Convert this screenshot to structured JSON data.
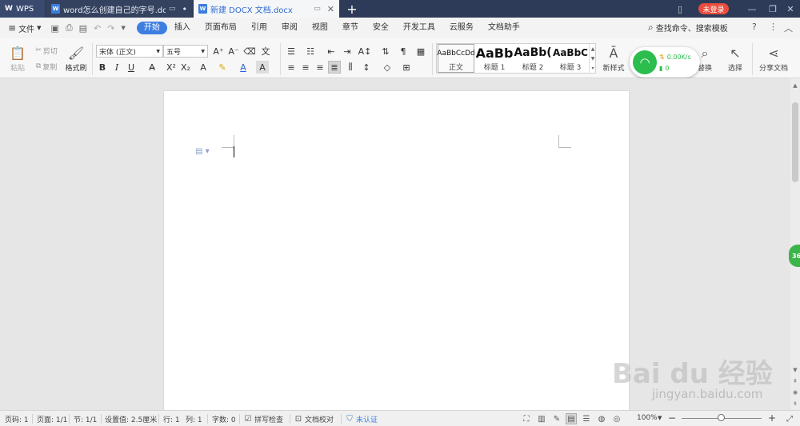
{
  "titlebar": {
    "app_name": "WPS",
    "tabs": [
      {
        "label": "word怎么创建自己的字号.docx",
        "state": "inactive"
      },
      {
        "label": "新建 DOCX 文档.docx",
        "state": "active"
      }
    ],
    "new_tab": "+",
    "login_label": "未登录"
  },
  "menubar": {
    "file_label": "文件",
    "tabs": [
      "开始",
      "插入",
      "页面布局",
      "引用",
      "审阅",
      "视图",
      "章节",
      "安全",
      "开发工具",
      "云服务",
      "文档助手"
    ],
    "active_tab": "开始",
    "search_label": "查找命令、搜索模板",
    "help": "?"
  },
  "ribbon": {
    "paste_label": "粘贴",
    "cut_label": "剪切",
    "copy_label": "复制",
    "format_painter_label": "格式刷",
    "font_name": "宋体 (正文)",
    "font_size": "五号",
    "styles": [
      {
        "sample": "AaBbCcDd",
        "name": "正文"
      },
      {
        "sample": "AaBb",
        "name": "标题 1"
      },
      {
        "sample": "AaBb(",
        "name": "标题 2"
      },
      {
        "sample": "AaBbC",
        "name": "标题 3"
      }
    ],
    "new_style_label": "新样式",
    "replace_label": "替换",
    "select_label": "选择",
    "share_label": "分享文档"
  },
  "wifi_widget": {
    "speed": "0.00K/s",
    "count": "0"
  },
  "side_badge": "36",
  "watermark": {
    "main": "Bai du 经验",
    "sub": "jingyan.baidu.com"
  },
  "statusbar": {
    "page_no": "页码: 1",
    "pages": "页面: 1/1",
    "section": "节: 1/1",
    "setting": "设置值: 2.5厘米",
    "row": "行: 1",
    "col": "列: 1",
    "words": "字数: 0",
    "spellcheck": "拼写检查",
    "proofread": "文档校对",
    "auth": "未认证",
    "zoom": "100%"
  },
  "colors": {
    "accent": "#3d7ee0",
    "titlebar_bg": "#2e3b58",
    "login": "#e94b3c",
    "wifi": "#2bbd4e"
  }
}
